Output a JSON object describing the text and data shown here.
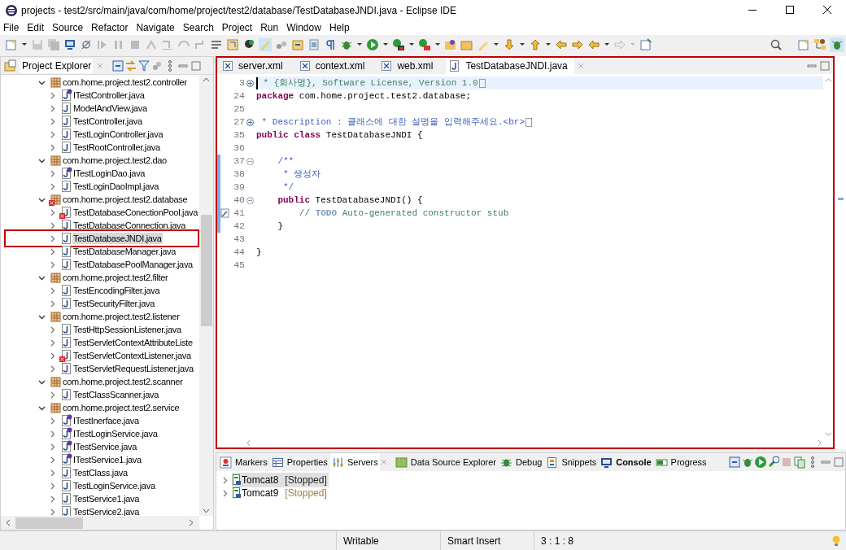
{
  "window": {
    "title": "projects - test2/src/main/java/com/home/project/test2/database/TestDatabaseJNDI.java - Eclipse IDE"
  },
  "menu": [
    "File",
    "Edit",
    "Source",
    "Refactor",
    "Navigate",
    "Search",
    "Project",
    "Run",
    "Window",
    "Help"
  ],
  "project_explorer": {
    "title": "Project Explorer",
    "tree": [
      {
        "label": "com.home.project.test2.controller",
        "kind": "package",
        "expanded": true,
        "error": false,
        "children": [
          {
            "label": "ITestController.java",
            "kind": "interface",
            "error": false,
            "selected": false,
            "highlighted": false
          },
          {
            "label": "ModelAndView.java",
            "kind": "class",
            "error": false,
            "selected": false,
            "highlighted": false
          },
          {
            "label": "TestController.java",
            "kind": "class",
            "error": false,
            "selected": false,
            "highlighted": false
          },
          {
            "label": "TestLoginController.java",
            "kind": "class",
            "error": false,
            "selected": false,
            "highlighted": false
          },
          {
            "label": "TestRootController.java",
            "kind": "class",
            "error": false,
            "selected": false,
            "highlighted": false
          }
        ]
      },
      {
        "label": "com.home.project.test2.dao",
        "kind": "package",
        "expanded": true,
        "error": false,
        "children": [
          {
            "label": "ITestLoginDao.java",
            "kind": "interface",
            "error": false,
            "selected": false,
            "highlighted": false
          },
          {
            "label": "TestLoginDaoImpl.java",
            "kind": "class",
            "error": false,
            "selected": false,
            "highlighted": false
          }
        ]
      },
      {
        "label": "com.home.project.test2.database",
        "kind": "package",
        "expanded": true,
        "error": true,
        "children": [
          {
            "label": "TestDatabaseConectionPool.java",
            "kind": "class",
            "error": true,
            "selected": false,
            "highlighted": false
          },
          {
            "label": "TestDatabaseConnection.java",
            "kind": "class",
            "error": false,
            "selected": false,
            "highlighted": false
          },
          {
            "label": "TestDatabaseJNDI.java",
            "kind": "class",
            "error": false,
            "selected": true,
            "highlighted": true
          },
          {
            "label": "TestDatabaseManager.java",
            "kind": "class",
            "error": false,
            "selected": false,
            "highlighted": false
          },
          {
            "label": "TestDatabasePoolManager.java",
            "kind": "class",
            "error": false,
            "selected": false,
            "highlighted": false
          }
        ]
      },
      {
        "label": "com.home.project.test2.filter",
        "kind": "package",
        "expanded": true,
        "error": false,
        "children": [
          {
            "label": "TestEncodingFilter.java",
            "kind": "class",
            "error": false,
            "selected": false,
            "highlighted": false
          },
          {
            "label": "TestSecurityFilter.java",
            "kind": "class",
            "error": false,
            "selected": false,
            "highlighted": false
          }
        ]
      },
      {
        "label": "com.home.project.test2.listener",
        "kind": "package",
        "expanded": true,
        "error": false,
        "children": [
          {
            "label": "TestHttpSessionListener.java",
            "kind": "class",
            "error": false,
            "selected": false,
            "highlighted": false
          },
          {
            "label": "TestServletContextAttributeListe",
            "kind": "class",
            "error": false,
            "selected": false,
            "highlighted": false
          },
          {
            "label": "TestServletContextListener.java",
            "kind": "class",
            "error": true,
            "selected": false,
            "highlighted": false
          },
          {
            "label": "TestServletRequestListener.java",
            "kind": "class",
            "error": false,
            "selected": false,
            "highlighted": false
          }
        ]
      },
      {
        "label": "com.home.project.test2.scanner",
        "kind": "package",
        "expanded": true,
        "error": false,
        "children": [
          {
            "label": "TestClassScanner.java",
            "kind": "class",
            "error": false,
            "selected": false,
            "highlighted": false
          }
        ]
      },
      {
        "label": "com.home.project.test2.service",
        "kind": "package",
        "expanded": true,
        "error": false,
        "children": [
          {
            "label": "ITestInerface.java",
            "kind": "interface",
            "error": false,
            "selected": false,
            "highlighted": false
          },
          {
            "label": "ITestLoginService.java",
            "kind": "interface",
            "error": false,
            "selected": false,
            "highlighted": false
          },
          {
            "label": "ITestService.java",
            "kind": "interface",
            "error": false,
            "selected": false,
            "highlighted": false
          },
          {
            "label": "ITestService1.java",
            "kind": "interface",
            "error": false,
            "selected": false,
            "highlighted": false
          },
          {
            "label": "TestClass.java",
            "kind": "class",
            "error": false,
            "selected": false,
            "highlighted": false
          },
          {
            "label": "TestLoginService.java",
            "kind": "class",
            "error": false,
            "selected": false,
            "highlighted": false
          },
          {
            "label": "TestService1.java",
            "kind": "class",
            "error": false,
            "selected": false,
            "highlighted": false
          },
          {
            "label": "TestService2.java",
            "kind": "class",
            "error": false,
            "selected": false,
            "highlighted": false
          }
        ]
      }
    ]
  },
  "editor": {
    "highlighted": true,
    "tabs": [
      {
        "label": "server.xml",
        "kind": "xml",
        "selected": false
      },
      {
        "label": "context.xml",
        "kind": "xml",
        "selected": false
      },
      {
        "label": "web.xml",
        "kind": "xml",
        "selected": false
      },
      {
        "label": "TestDatabaseJNDI.java",
        "kind": "java",
        "selected": true
      }
    ],
    "lines": [
      {
        "number": "3",
        "folded": true,
        "foldable": false,
        "current": true,
        "changed": false,
        "task": false,
        "tokens": [
          {
            "kind": "comment",
            "text": " * {회사명}, Software License, Version 1.0"
          }
        ]
      },
      {
        "number": "24",
        "folded": false,
        "foldable": false,
        "current": false,
        "changed": false,
        "task": false,
        "tokens": [
          {
            "kind": "keyword",
            "text": "package"
          },
          {
            "kind": "plain",
            "text": " com.home.project.test2.database;"
          }
        ]
      },
      {
        "number": "25",
        "folded": false,
        "foldable": false,
        "current": false,
        "changed": false,
        "task": false
      },
      {
        "number": "27",
        "folded": true,
        "foldable": false,
        "current": false,
        "changed": false,
        "task": false,
        "tokens": [
          {
            "kind": "javadoc",
            "text": " * Description : 클래스에 대한 설명을 입력해주세요.<br>"
          }
        ]
      },
      {
        "number": "35",
        "folded": false,
        "foldable": false,
        "current": false,
        "changed": false,
        "task": false,
        "tokens": [
          {
            "kind": "keyword",
            "text": "public class"
          },
          {
            "kind": "plain",
            "text": " TestDatabaseJNDI {"
          }
        ]
      },
      {
        "number": "36",
        "folded": false,
        "foldable": false,
        "current": false,
        "changed": false,
        "task": false
      },
      {
        "number": "37",
        "folded": false,
        "foldable": true,
        "current": false,
        "changed": true,
        "task": false,
        "tokens": [
          {
            "kind": "javadoc",
            "text": "    /**"
          }
        ]
      },
      {
        "number": "38",
        "folded": false,
        "foldable": false,
        "current": false,
        "changed": true,
        "task": false,
        "tokens": [
          {
            "kind": "javadoc",
            "text": "     * 생성자"
          }
        ]
      },
      {
        "number": "39",
        "folded": false,
        "foldable": false,
        "current": false,
        "changed": true,
        "task": false,
        "tokens": [
          {
            "kind": "javadoc",
            "text": "     */"
          }
        ]
      },
      {
        "number": "40",
        "folded": false,
        "foldable": true,
        "current": false,
        "changed": true,
        "task": false,
        "tokens": [
          {
            "kind": "keyword",
            "text": "    public"
          },
          {
            "kind": "plain",
            "text": " TestDatabaseJNDI() {"
          }
        ]
      },
      {
        "number": "41",
        "folded": false,
        "foldable": false,
        "current": false,
        "changed": true,
        "task": true,
        "tokens": [
          {
            "kind": "comment",
            "text": "        // "
          },
          {
            "kind": "todo",
            "text": "TODO"
          },
          {
            "kind": "comment",
            "text": " Auto-generated constructor stub"
          }
        ]
      },
      {
        "number": "42",
        "folded": false,
        "foldable": false,
        "current": false,
        "changed": true,
        "task": false,
        "tokens": [
          {
            "kind": "plain",
            "text": "    }"
          }
        ]
      },
      {
        "number": "43",
        "folded": false,
        "foldable": false,
        "current": false,
        "changed": false,
        "task": false
      },
      {
        "number": "44",
        "folded": false,
        "foldable": false,
        "current": false,
        "changed": false,
        "task": false,
        "tokens": [
          {
            "kind": "plain",
            "text": "}"
          }
        ]
      },
      {
        "number": "45",
        "folded": false,
        "foldable": false,
        "current": false,
        "changed": false,
        "task": false
      }
    ]
  },
  "bottom_panel": {
    "tabs": [
      {
        "label": "Markers",
        "kind": "markers",
        "selected": false,
        "bold": false
      },
      {
        "label": "Properties",
        "kind": "properties",
        "selected": false,
        "bold": false
      },
      {
        "label": "Servers",
        "kind": "servers",
        "selected": true,
        "bold": false
      },
      {
        "label": "Data Source Explorer",
        "kind": "datasource",
        "selected": false,
        "bold": false
      },
      {
        "label": "Debug",
        "kind": "debug",
        "selected": false,
        "bold": false
      },
      {
        "label": "Snippets",
        "kind": "snippets",
        "selected": false,
        "bold": false
      },
      {
        "label": "Console",
        "kind": "console",
        "selected": false,
        "bold": true
      },
      {
        "label": "Progress",
        "kind": "progress",
        "selected": false,
        "bold": false
      }
    ],
    "servers": [
      {
        "name": "Tomcat8",
        "state": "[Stopped]",
        "selected": true
      },
      {
        "name": "Tomcat9",
        "state": "[Stopped]",
        "selected": false
      }
    ]
  },
  "status_bar": [
    "Writable",
    "Smart Insert",
    "3 : 1 : 8"
  ]
}
